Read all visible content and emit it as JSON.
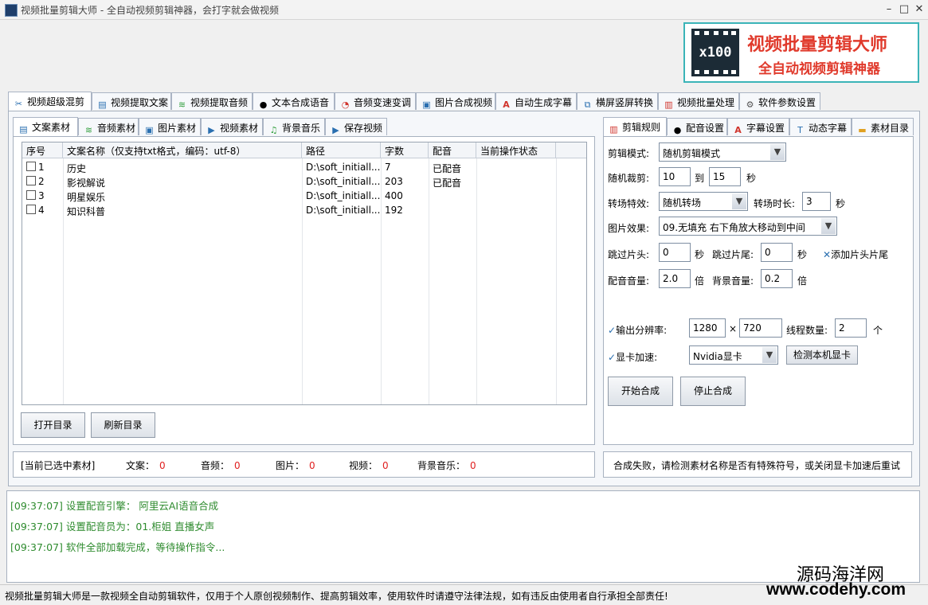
{
  "window": {
    "title": "视频批量剪辑大师 - 全自动视频剪辑神器，会打字就会做视频",
    "controls": [
      "–",
      "□",
      "✕"
    ]
  },
  "logo": {
    "badge": "x100",
    "line1": "视频批量剪辑大师",
    "line2": "全自动视频剪辑神器"
  },
  "main_tabs": [
    {
      "label": "视频超级混剪",
      "icon": "scissors-icon"
    },
    {
      "label": "视频提取文案",
      "icon": "document-icon"
    },
    {
      "label": "视频提取音频",
      "icon": "audio-wave-icon"
    },
    {
      "label": "文本合成语音",
      "icon": "microphone-icon"
    },
    {
      "label": "音频变速变调",
      "icon": "gauge-icon"
    },
    {
      "label": "图片合成视频",
      "icon": "image-icon"
    },
    {
      "label": "自动生成字幕",
      "icon": "text-a-icon"
    },
    {
      "label": "横屏竖屏转换",
      "icon": "rotate-screen-icon"
    },
    {
      "label": "视频批量处理",
      "icon": "video-icon"
    },
    {
      "label": "软件参数设置",
      "icon": "gear-icon"
    }
  ],
  "left_tabs": [
    {
      "label": "文案素材"
    },
    {
      "label": "音频素材"
    },
    {
      "label": "图片素材"
    },
    {
      "label": "视频素材"
    },
    {
      "label": "背景音乐"
    },
    {
      "label": "保存视频"
    }
  ],
  "table": {
    "columns": [
      "序号",
      "文案名称（仅支持txt格式，编码：utf-8）",
      "路径",
      "字数",
      "配音",
      "当前操作状态"
    ],
    "rows": [
      {
        "no": "1",
        "name": "历史",
        "path": "D:\\soft_initiall...",
        "chars": "7",
        "dub": "已配音",
        "status": ""
      },
      {
        "no": "2",
        "name": "影视解说",
        "path": "D:\\soft_initiall...",
        "chars": "203",
        "dub": "已配音",
        "status": ""
      },
      {
        "no": "3",
        "name": "明星娱乐",
        "path": "D:\\soft_initiall...",
        "chars": "400",
        "dub": "",
        "status": ""
      },
      {
        "no": "4",
        "name": "知识科普",
        "path": "D:\\soft_initiall...",
        "chars": "192",
        "dub": "",
        "status": ""
      }
    ]
  },
  "left_buttons": {
    "open_dir": "打开目录",
    "refresh_dir": "刷新目录"
  },
  "selected_summary": {
    "title": "[当前已选中素材]",
    "items": [
      {
        "label": "文案：",
        "value": "0"
      },
      {
        "label": "音频：",
        "value": "0"
      },
      {
        "label": "图片：",
        "value": "0"
      },
      {
        "label": "视频：",
        "value": "0"
      },
      {
        "label": "背景音乐：",
        "value": "0"
      }
    ]
  },
  "right_tabs": [
    {
      "label": "剪辑规则"
    },
    {
      "label": "配音设置"
    },
    {
      "label": "字幕设置"
    },
    {
      "label": "动态字幕"
    },
    {
      "label": "素材目录"
    }
  ],
  "settings": {
    "edit_mode_label": "剪辑模式:",
    "edit_mode_value": "随机剪辑模式",
    "random_cut_label": "随机裁剪:",
    "random_cut_from": "10",
    "random_cut_to_label": "到",
    "random_cut_to": "15",
    "random_cut_unit": "秒",
    "transition_label": "转场特效:",
    "transition_value": "随机转场",
    "transition_dur_label": "转场时长:",
    "transition_dur_value": "3",
    "transition_dur_unit": "秒",
    "image_effect_label": "图片效果:",
    "image_effect_value": "09.无填充 右下角放大移动到中间",
    "skip_head_label": "跳过片头:",
    "skip_head_value": "0",
    "skip_head_unit": "秒",
    "skip_tail_label": "跳过片尾:",
    "skip_tail_value": "0",
    "skip_tail_unit": "秒",
    "add_head_tail": "添加片头片尾",
    "dub_volume_label": "配音音量:",
    "dub_volume_value": "2.0",
    "dub_volume_unit": "倍",
    "bg_volume_label": "背景音量:",
    "bg_volume_value": "0.2",
    "bg_volume_unit": "倍",
    "resolution_label": "输出分辨率:",
    "res_w": "1280",
    "res_x": "×",
    "res_h": "720",
    "threads_label": "线程数量:",
    "threads_value": "2",
    "threads_unit": "个",
    "gpu_label": "显卡加速:",
    "gpu_value": "Nvidia显卡",
    "detect_gpu": "检测本机显卡",
    "start_btn": "开始合成",
    "stop_btn": "停止合成"
  },
  "error_message": "合成失败，请检测素材名称是否有特殊符号，或关闭显卡加速后重试",
  "log": [
    {
      "time": "[09:37:07]",
      "text": "设置配音引擎：  阿里云AI语音合成"
    },
    {
      "time": "[09:37:07]",
      "text": "设置配音员为：01.柜姐 直播女声"
    },
    {
      "time": "[09:37:07]",
      "text": "软件全部加载完成，等待操作指令..."
    }
  ],
  "status_bar": "视频批量剪辑大师是一款视频全自动剪辑软件，仅用于个人原创视频制作、提高剪辑效率，使用软件时请遵守法律法规，如有违反由使用者自行承担全部责任!",
  "watermark": {
    "line1": "源码海洋网",
    "line2": "www.codehy.com"
  },
  "colors": {
    "accent_teal": "#3bb4b8",
    "logo_red": "#e03a2c",
    "log_green": "#2e8b2e",
    "count_red": "#e02020"
  }
}
